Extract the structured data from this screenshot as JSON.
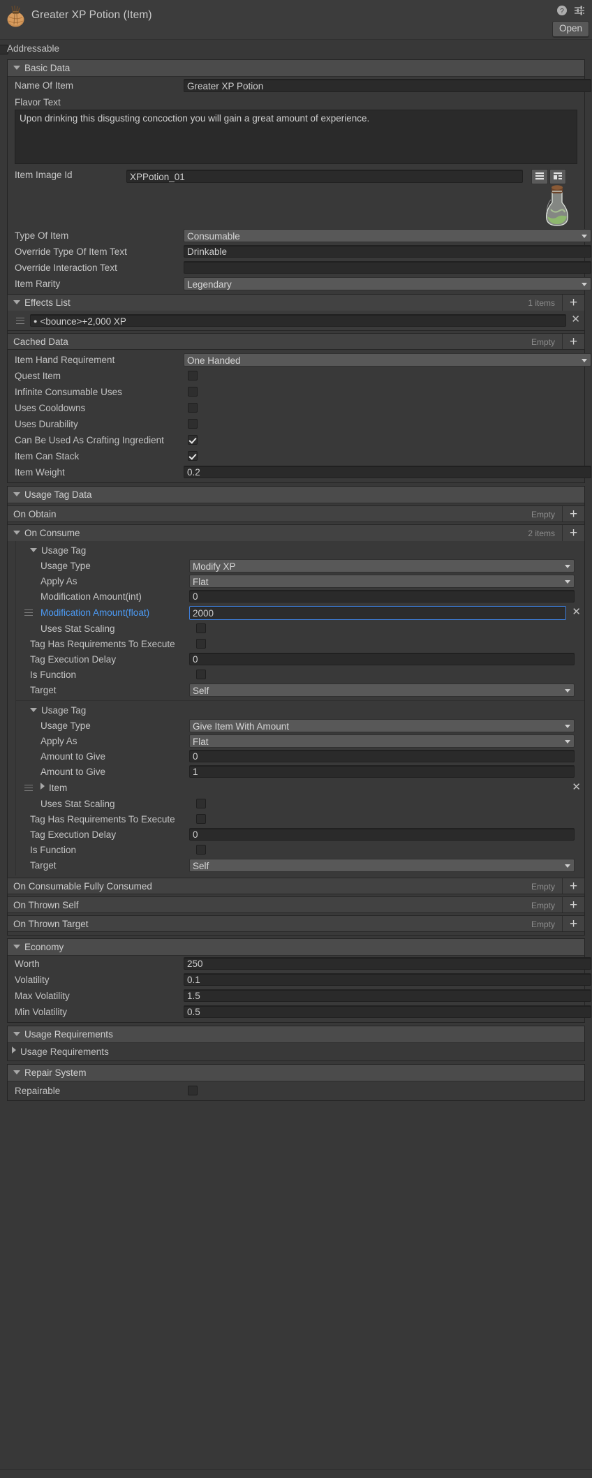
{
  "header": {
    "title": "Greater XP Potion (Item)",
    "icon": "item-asset-icon",
    "help_icon": "help-icon",
    "preset_icon": "preset-settings-icon",
    "open_label": "Open"
  },
  "addressable": {
    "label": "Addressable",
    "checked": false
  },
  "basic_data": {
    "title": "Basic Data",
    "name_of_item": {
      "label": "Name Of Item",
      "value": "Greater XP Potion"
    },
    "flavor_text": {
      "label": "Flavor Text",
      "value": "Upon drinking this disgusting concoction you will gain a great amount of experience."
    },
    "item_image_id": {
      "label": "Item Image Id",
      "value": "XPPotion_01"
    },
    "image_buttons": [
      "list-view-icon",
      "detail-view-icon"
    ],
    "sprite_name": "xp-potion-sprite",
    "type_of_item": {
      "label": "Type Of Item",
      "value": "Consumable"
    },
    "override_type_of_item_text": {
      "label": "Override Type Of Item Text",
      "value": "Drinkable"
    },
    "override_interaction_text": {
      "label": "Override Interaction Text",
      "value": ""
    },
    "item_rarity": {
      "label": "Item Rarity",
      "value": "Legendary"
    },
    "effects_list": {
      "label": "Effects List",
      "count": "1 items",
      "items": [
        "<bounce>+2,000 XP"
      ]
    },
    "cached_data": {
      "label": "Cached Data",
      "count": "Empty"
    },
    "item_hand_requirement": {
      "label": "Item Hand Requirement",
      "value": "One Handed"
    },
    "toggles": [
      {
        "label": "Quest Item",
        "checked": false
      },
      {
        "label": "Infinite Consumable Uses",
        "checked": false
      },
      {
        "label": "Uses Cooldowns",
        "checked": false
      },
      {
        "label": "Uses Durability",
        "checked": false
      },
      {
        "label": "Can Be Used As Crafting Ingredient",
        "checked": true
      },
      {
        "label": "Item Can Stack",
        "checked": true
      }
    ],
    "item_weight": {
      "label": "Item Weight",
      "value": "0.2"
    }
  },
  "usage_tag_data": {
    "title": "Usage Tag Data",
    "on_obtain": {
      "label": "On Obtain",
      "count": "Empty"
    },
    "on_consume": {
      "label": "On Consume",
      "count": "2 items"
    },
    "tags": [
      {
        "title": "Usage Tag",
        "usage_type": {
          "label": "Usage Type",
          "value": "Modify XP"
        },
        "apply_as": {
          "label": "Apply As",
          "value": "Flat"
        },
        "fields": [
          {
            "label": "Modification Amount(int)",
            "value": "0",
            "selected": false,
            "highlight": false
          },
          {
            "label": "Modification Amount(float)",
            "value": "2000",
            "selected": true,
            "highlight": true
          }
        ],
        "uses_stat_scaling": {
          "label": "Uses Stat Scaling",
          "checked": false
        },
        "tag_has_requirements": {
          "label": "Tag Has Requirements To Execute",
          "checked": false
        },
        "tag_execution_delay": {
          "label": "Tag Execution Delay",
          "value": "0"
        },
        "is_function": {
          "label": "Is Function",
          "checked": false
        },
        "target": {
          "label": "Target",
          "value": "Self"
        }
      },
      {
        "title": "Usage Tag",
        "usage_type": {
          "label": "Usage Type",
          "value": "Give Item With Amount"
        },
        "apply_as": {
          "label": "Apply As",
          "value": "Flat"
        },
        "fields": [
          {
            "label": "Amount to Give",
            "value": "0",
            "selected": false,
            "highlight": false
          },
          {
            "label": "Amount to Give",
            "value": "1",
            "selected": false,
            "highlight": false
          }
        ],
        "item_ref": {
          "label": "Item"
        },
        "uses_stat_scaling": {
          "label": "Uses Stat Scaling",
          "checked": false
        },
        "tag_has_requirements": {
          "label": "Tag Has Requirements To Execute",
          "checked": false
        },
        "tag_execution_delay": {
          "label": "Tag Execution Delay",
          "value": "0"
        },
        "is_function": {
          "label": "Is Function",
          "checked": false
        },
        "target": {
          "label": "Target",
          "value": "Self"
        }
      }
    ],
    "on_consumable_fully_consumed": {
      "label": "On Consumable Fully Consumed",
      "count": "Empty"
    },
    "on_thrown_self": {
      "label": "On Thrown Self",
      "count": "Empty"
    },
    "on_thrown_target": {
      "label": "On Thrown Target",
      "count": "Empty"
    }
  },
  "economy": {
    "title": "Economy",
    "rows": [
      {
        "label": "Worth",
        "value": "250"
      },
      {
        "label": "Volatility",
        "value": "0.1"
      },
      {
        "label": "Max Volatility",
        "value": "1.5"
      },
      {
        "label": "Min Volatility",
        "value": "0.5"
      }
    ]
  },
  "usage_requirements": {
    "title": "Usage Requirements",
    "sub_label": "Usage Requirements"
  },
  "repair_system": {
    "title": "Repair System",
    "repairable": {
      "label": "Repairable",
      "checked": false
    }
  },
  "colors": {
    "background": "#383838",
    "header_bar": "#4b4b4b",
    "field_bg": "#2a2a2a",
    "popup_bg": "#585858",
    "selection_blue": "#3e80dd",
    "label_blue": "#4c9bf5",
    "text": "#c4c4c4",
    "muted": "#8c8c8c"
  }
}
